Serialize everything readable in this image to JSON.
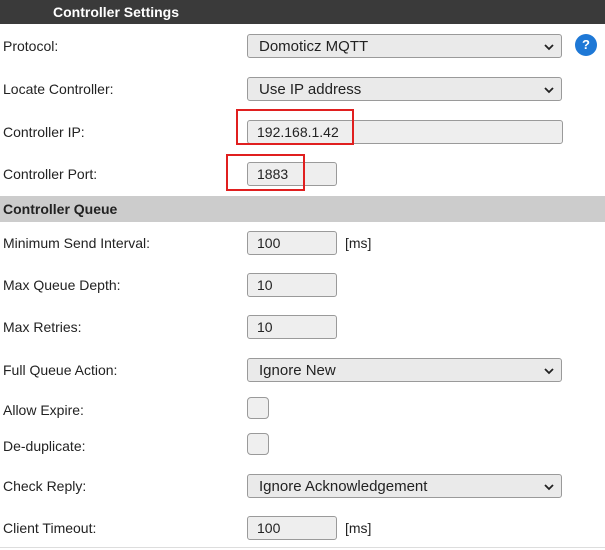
{
  "header": {
    "title": "Controller Settings"
  },
  "controller": {
    "protocol": {
      "label": "Protocol:",
      "value": "Domoticz MQTT"
    },
    "locate": {
      "label": "Locate Controller:",
      "value": "Use IP address"
    },
    "ip": {
      "label": "Controller IP:",
      "value": "192.168.1.42"
    },
    "port": {
      "label": "Controller Port:",
      "value": "1883"
    },
    "help_label": "?"
  },
  "queue": {
    "title": "Controller Queue",
    "min_send_interval": {
      "label": "Minimum Send Interval:",
      "value": "100",
      "unit": "[ms]"
    },
    "max_queue_depth": {
      "label": "Max Queue Depth:",
      "value": "10"
    },
    "max_retries": {
      "label": "Max Retries:",
      "value": "10"
    },
    "full_queue_action": {
      "label": "Full Queue Action:",
      "value": "Ignore New"
    },
    "allow_expire": {
      "label": "Allow Expire:",
      "checked": false
    },
    "deduplicate": {
      "label": "De-duplicate:",
      "checked": false
    },
    "check_reply": {
      "label": "Check Reply:",
      "value": "Ignore Acknowledgement"
    },
    "client_timeout": {
      "label": "Client Timeout:",
      "value": "100",
      "unit": "[ms]"
    }
  },
  "colors": {
    "header_bg": "#3a3a3a",
    "section_bg": "#cccccc",
    "help_icon": "#1e78d6",
    "highlight": "#e01f1f"
  }
}
